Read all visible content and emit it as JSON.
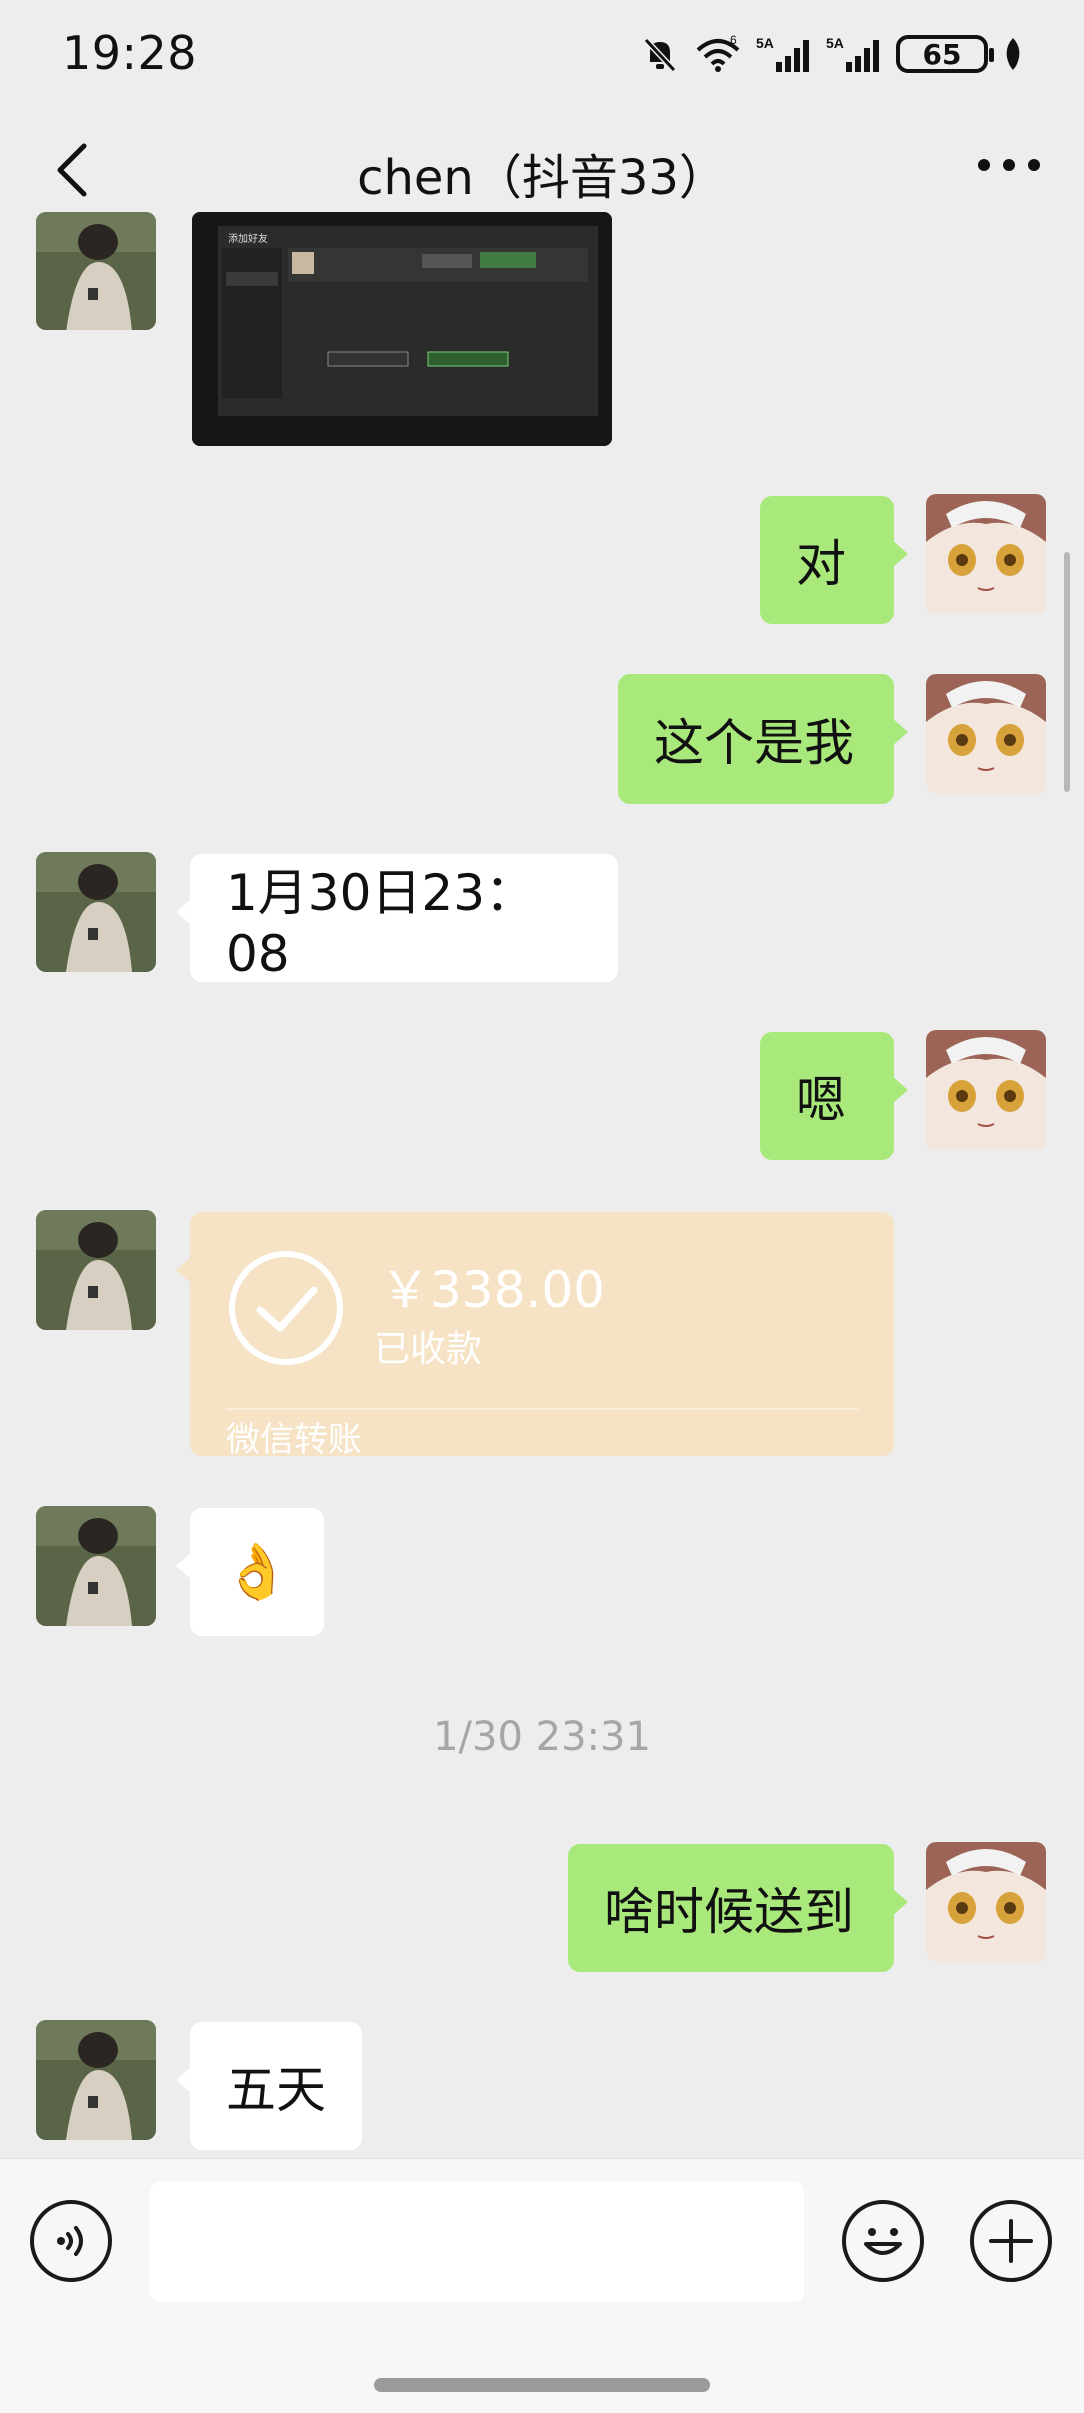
{
  "status_bar": {
    "time": "19:28",
    "battery": "65",
    "icons": [
      "mute-bell-icon",
      "wifi-icon",
      "signal-5a-icon",
      "signal-5a-icon",
      "battery-icon",
      "leaf-icon"
    ]
  },
  "header": {
    "title": "chen（抖音33）",
    "back_icon": "chevron-left-icon",
    "more_icon": "more-dots-icon"
  },
  "messages": {
    "m1": "对",
    "m2": "这个是我",
    "m3": "1月30日23：08",
    "m4": "嗯",
    "m5": "👌",
    "m6": "啥时候送到",
    "m7": "五天"
  },
  "transfer": {
    "amount": "￥338.00",
    "status": "已收款",
    "footer": "微信转账",
    "icon": "check-circle-icon"
  },
  "timestamp": "1/30 23:31",
  "image_message": {
    "heading": "添加好友"
  },
  "input_bar": {
    "placeholder": "",
    "voice_icon": "voice-icon",
    "emoji_icon": "emoji-icon",
    "plus_icon": "plus-icon"
  },
  "colors": {
    "background": "#ededed",
    "sent_bubble": "#a9e97c",
    "received_bubble": "#ffffff",
    "transfer_card": "#f6e3c5"
  }
}
